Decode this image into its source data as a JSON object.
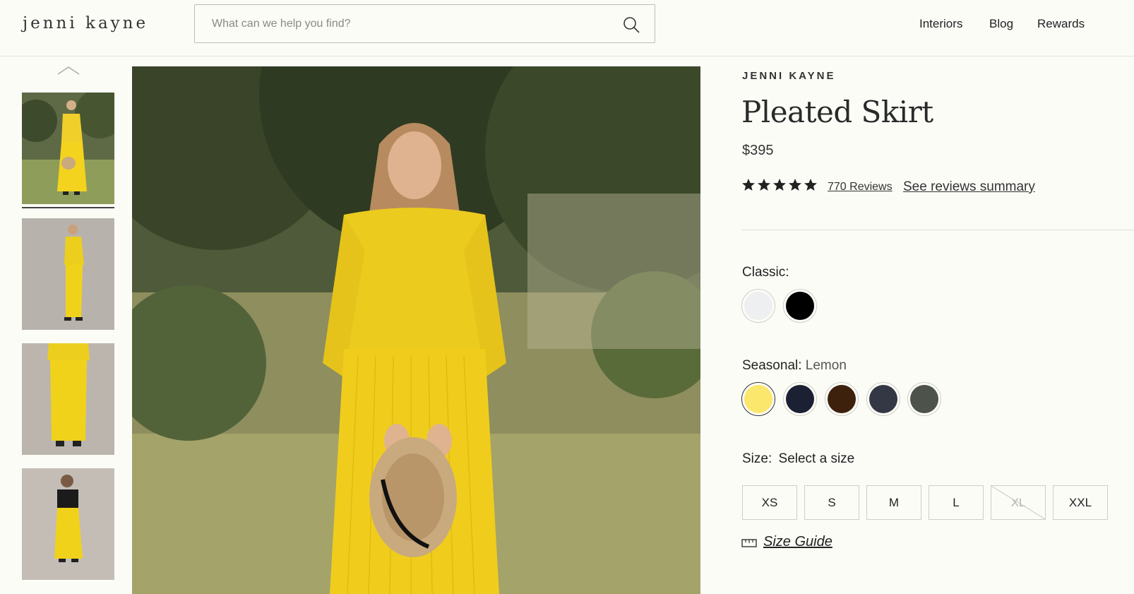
{
  "header": {
    "logo": "jenni kayne",
    "search_placeholder": "What can we help you find?",
    "nav": [
      "Interiors",
      "Blog",
      "Rewards"
    ]
  },
  "gallery": {
    "thumbnails": [
      {
        "alt": "woman in yellow sweater and pleated skirt holding hat, outdoors"
      },
      {
        "alt": "side view of yellow outfit in studio"
      },
      {
        "alt": "skirt close-up with arms crossed"
      },
      {
        "alt": "woman in black tee and yellow pleated skirt"
      }
    ]
  },
  "product": {
    "brand": "JENNI KAYNE",
    "title": "Pleated Skirt",
    "price": "$395",
    "rating": 5,
    "reviews_label": "770 Reviews",
    "summary_label": "See reviews summary",
    "classic_label": "Classic:",
    "classic_colors": [
      {
        "name": "white",
        "hex": "#eeeff0"
      },
      {
        "name": "black",
        "hex": "#000000"
      }
    ],
    "seasonal_label": "Seasonal:",
    "seasonal_selected": "Lemon",
    "seasonal_colors": [
      {
        "name": "Lemon",
        "hex": "#fbe76b"
      },
      {
        "name": "navy",
        "hex": "#1c2033"
      },
      {
        "name": "brown",
        "hex": "#3d210c"
      },
      {
        "name": "charcoal",
        "hex": "#343744"
      },
      {
        "name": "olive",
        "hex": "#4d524b"
      }
    ],
    "size_label": "Size:",
    "size_prompt": "Select a size",
    "sizes": [
      {
        "label": "XS",
        "available": true
      },
      {
        "label": "S",
        "available": true
      },
      {
        "label": "M",
        "available": true
      },
      {
        "label": "L",
        "available": true
      },
      {
        "label": "XL",
        "available": false
      },
      {
        "label": "XXL",
        "available": true
      }
    ],
    "size_guide_label": "Size Guide"
  }
}
